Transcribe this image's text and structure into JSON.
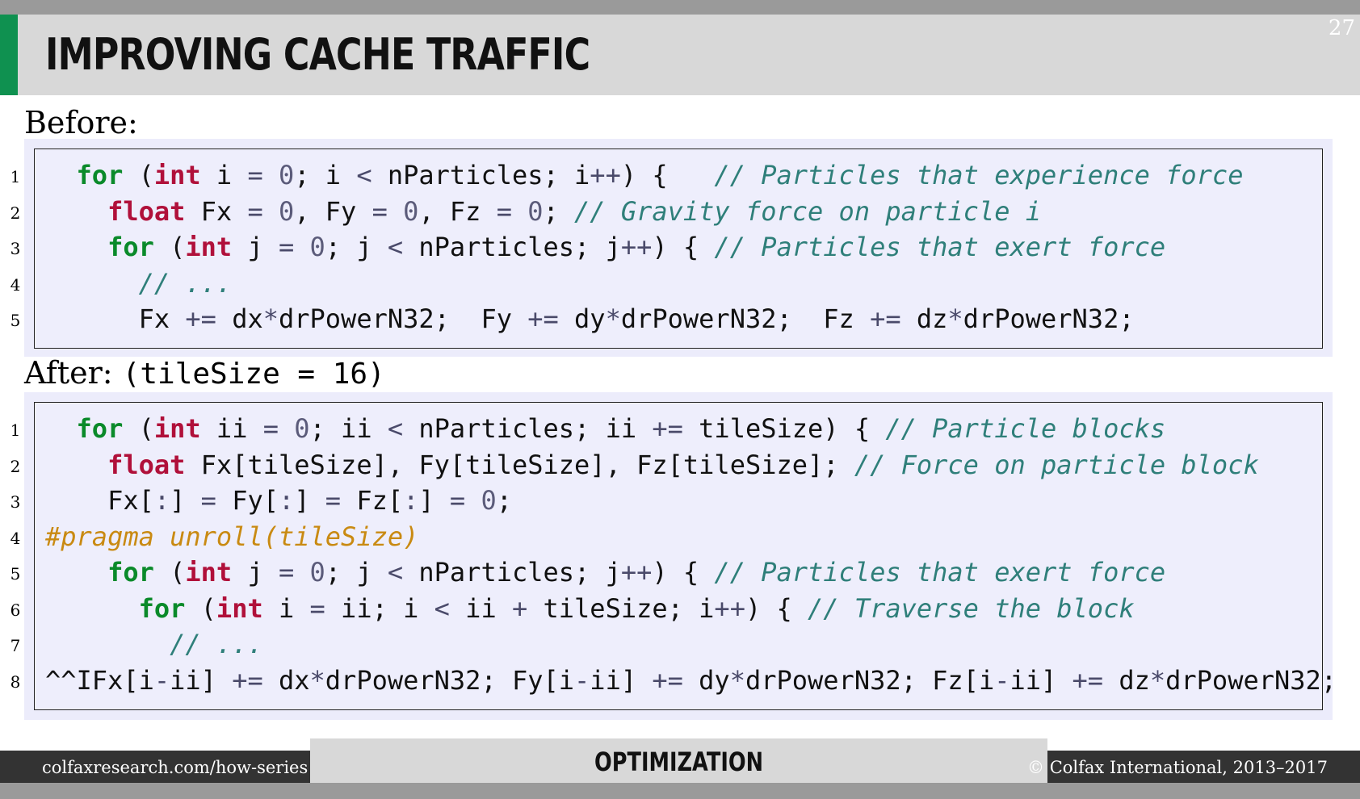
{
  "slide": {
    "title": "Improving Cache Traffic",
    "page_number": "27"
  },
  "before": {
    "label": "Before:",
    "lines": [
      {
        "num": "1",
        "indent": "  ",
        "segments": [
          {
            "t": "kw",
            "v": "for"
          },
          {
            "t": "plain",
            "v": " ("
          },
          {
            "t": "ty",
            "v": "int"
          },
          {
            "t": "plain",
            "v": " i "
          },
          {
            "t": "op",
            "v": "="
          },
          {
            "t": "plain",
            "v": " "
          },
          {
            "t": "num",
            "v": "0"
          },
          {
            "t": "plain",
            "v": "; i "
          },
          {
            "t": "op",
            "v": "<"
          },
          {
            "t": "plain",
            "v": " nParticles; i"
          },
          {
            "t": "op",
            "v": "++"
          },
          {
            "t": "plain",
            "v": ") {   "
          },
          {
            "t": "cm",
            "v": "// Particles that experience force"
          }
        ]
      },
      {
        "num": "2",
        "indent": "    ",
        "segments": [
          {
            "t": "ty",
            "v": "float"
          },
          {
            "t": "plain",
            "v": " Fx "
          },
          {
            "t": "op",
            "v": "="
          },
          {
            "t": "plain",
            "v": " "
          },
          {
            "t": "num",
            "v": "0"
          },
          {
            "t": "plain",
            "v": ", Fy "
          },
          {
            "t": "op",
            "v": "="
          },
          {
            "t": "plain",
            "v": " "
          },
          {
            "t": "num",
            "v": "0"
          },
          {
            "t": "plain",
            "v": ", Fz "
          },
          {
            "t": "op",
            "v": "="
          },
          {
            "t": "plain",
            "v": " "
          },
          {
            "t": "num",
            "v": "0"
          },
          {
            "t": "plain",
            "v": "; "
          },
          {
            "t": "cm",
            "v": "// Gravity force on particle i"
          }
        ]
      },
      {
        "num": "3",
        "indent": "    ",
        "segments": [
          {
            "t": "kw",
            "v": "for"
          },
          {
            "t": "plain",
            "v": " ("
          },
          {
            "t": "ty",
            "v": "int"
          },
          {
            "t": "plain",
            "v": " j "
          },
          {
            "t": "op",
            "v": "="
          },
          {
            "t": "plain",
            "v": " "
          },
          {
            "t": "num",
            "v": "0"
          },
          {
            "t": "plain",
            "v": "; j "
          },
          {
            "t": "op",
            "v": "<"
          },
          {
            "t": "plain",
            "v": " nParticles; j"
          },
          {
            "t": "op",
            "v": "++"
          },
          {
            "t": "plain",
            "v": ") { "
          },
          {
            "t": "cm",
            "v": "// Particles that exert force"
          }
        ]
      },
      {
        "num": "4",
        "indent": "      ",
        "segments": [
          {
            "t": "cm",
            "v": "// ..."
          }
        ]
      },
      {
        "num": "5",
        "indent": "      ",
        "segments": [
          {
            "t": "plain",
            "v": "Fx "
          },
          {
            "t": "op",
            "v": "+="
          },
          {
            "t": "plain",
            "v": " dx"
          },
          {
            "t": "op",
            "v": "*"
          },
          {
            "t": "plain",
            "v": "drPowerN32;  Fy "
          },
          {
            "t": "op",
            "v": "+="
          },
          {
            "t": "plain",
            "v": " dy"
          },
          {
            "t": "op",
            "v": "*"
          },
          {
            "t": "plain",
            "v": "drPowerN32;  Fz "
          },
          {
            "t": "op",
            "v": "+="
          },
          {
            "t": "plain",
            "v": " dz"
          },
          {
            "t": "op",
            "v": "*"
          },
          {
            "t": "plain",
            "v": "drPowerN32;"
          }
        ]
      }
    ]
  },
  "after": {
    "label": "After:",
    "label_code": "(tileSize = 16)",
    "lines": [
      {
        "num": "1",
        "indent": "  ",
        "segments": [
          {
            "t": "kw",
            "v": "for"
          },
          {
            "t": "plain",
            "v": " ("
          },
          {
            "t": "ty",
            "v": "int"
          },
          {
            "t": "plain",
            "v": " ii "
          },
          {
            "t": "op",
            "v": "="
          },
          {
            "t": "plain",
            "v": " "
          },
          {
            "t": "num",
            "v": "0"
          },
          {
            "t": "plain",
            "v": "; ii "
          },
          {
            "t": "op",
            "v": "<"
          },
          {
            "t": "plain",
            "v": " nParticles; ii "
          },
          {
            "t": "op",
            "v": "+="
          },
          {
            "t": "plain",
            "v": " tileSize) { "
          },
          {
            "t": "cm",
            "v": "// Particle blocks"
          }
        ]
      },
      {
        "num": "2",
        "indent": "    ",
        "segments": [
          {
            "t": "ty",
            "v": "float"
          },
          {
            "t": "plain",
            "v": " Fx[tileSize], Fy[tileSize], Fz[tileSize]; "
          },
          {
            "t": "cm",
            "v": "// Force on particle block"
          }
        ]
      },
      {
        "num": "3",
        "indent": "    ",
        "segments": [
          {
            "t": "plain",
            "v": "Fx["
          },
          {
            "t": "op",
            "v": ":"
          },
          {
            "t": "plain",
            "v": "] "
          },
          {
            "t": "op",
            "v": "="
          },
          {
            "t": "plain",
            "v": " Fy["
          },
          {
            "t": "op",
            "v": ":"
          },
          {
            "t": "plain",
            "v": "] "
          },
          {
            "t": "op",
            "v": "="
          },
          {
            "t": "plain",
            "v": " Fz["
          },
          {
            "t": "op",
            "v": ":"
          },
          {
            "t": "plain",
            "v": "] "
          },
          {
            "t": "op",
            "v": "="
          },
          {
            "t": "plain",
            "v": " "
          },
          {
            "t": "num",
            "v": "0"
          },
          {
            "t": "plain",
            "v": ";"
          }
        ]
      },
      {
        "num": "4",
        "indent": "",
        "segments": [
          {
            "t": "pp",
            "v": "#pragma unroll(tileSize)"
          }
        ]
      },
      {
        "num": "5",
        "indent": "    ",
        "segments": [
          {
            "t": "kw",
            "v": "for"
          },
          {
            "t": "plain",
            "v": " ("
          },
          {
            "t": "ty",
            "v": "int"
          },
          {
            "t": "plain",
            "v": " j "
          },
          {
            "t": "op",
            "v": "="
          },
          {
            "t": "plain",
            "v": " "
          },
          {
            "t": "num",
            "v": "0"
          },
          {
            "t": "plain",
            "v": "; j "
          },
          {
            "t": "op",
            "v": "<"
          },
          {
            "t": "plain",
            "v": " nParticles; j"
          },
          {
            "t": "op",
            "v": "++"
          },
          {
            "t": "plain",
            "v": ") { "
          },
          {
            "t": "cm",
            "v": "// Particles that exert force"
          }
        ]
      },
      {
        "num": "6",
        "indent": "      ",
        "segments": [
          {
            "t": "kw",
            "v": "for"
          },
          {
            "t": "plain",
            "v": " ("
          },
          {
            "t": "ty",
            "v": "int"
          },
          {
            "t": "plain",
            "v": " i "
          },
          {
            "t": "op",
            "v": "="
          },
          {
            "t": "plain",
            "v": " ii; i "
          },
          {
            "t": "op",
            "v": "<"
          },
          {
            "t": "plain",
            "v": " ii "
          },
          {
            "t": "op",
            "v": "+"
          },
          {
            "t": "plain",
            "v": " tileSize; i"
          },
          {
            "t": "op",
            "v": "++"
          },
          {
            "t": "plain",
            "v": ") { "
          },
          {
            "t": "cm",
            "v": "// Traverse the block"
          }
        ]
      },
      {
        "num": "7",
        "indent": "        ",
        "segments": [
          {
            "t": "cm",
            "v": "// ..."
          }
        ]
      },
      {
        "num": "8",
        "indent": "",
        "segments": [
          {
            "t": "plain",
            "v": "^^IFx[i"
          },
          {
            "t": "op",
            "v": "-"
          },
          {
            "t": "plain",
            "v": "ii] "
          },
          {
            "t": "op",
            "v": "+="
          },
          {
            "t": "plain",
            "v": " dx"
          },
          {
            "t": "op",
            "v": "*"
          },
          {
            "t": "plain",
            "v": "drPowerN32; Fy[i"
          },
          {
            "t": "op",
            "v": "-"
          },
          {
            "t": "plain",
            "v": "ii] "
          },
          {
            "t": "op",
            "v": "+="
          },
          {
            "t": "plain",
            "v": " dy"
          },
          {
            "t": "op",
            "v": "*"
          },
          {
            "t": "plain",
            "v": "drPowerN32; Fz[i"
          },
          {
            "t": "op",
            "v": "-"
          },
          {
            "t": "plain",
            "v": "ii] "
          },
          {
            "t": "op",
            "v": "+="
          },
          {
            "t": "plain",
            "v": " dz"
          },
          {
            "t": "op",
            "v": "*"
          },
          {
            "t": "plain",
            "v": "drPowerN32;"
          }
        ]
      }
    ]
  },
  "footer": {
    "url": "colfaxresearch.com/how-series",
    "section": "Optimization",
    "copyright": "© Colfax International, 2013–2017"
  },
  "colors": {
    "accent_green": "#0f9150",
    "keyword": "#0a8a2a",
    "type": "#b0103a",
    "comment": "#2f7f7a",
    "preprocessor": "#c98a12",
    "code_background": "#eeeefc"
  }
}
